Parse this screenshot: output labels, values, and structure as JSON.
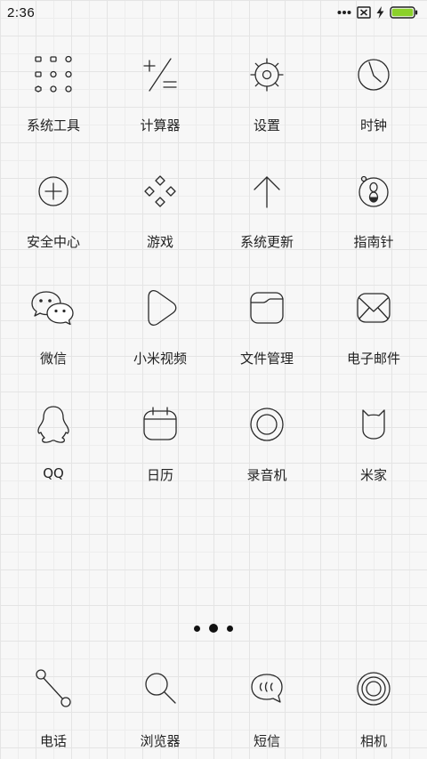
{
  "status_bar": {
    "time": "2:36",
    "battery_color": "#8bd12a",
    "icons": [
      "more-dots-icon",
      "sim-off-icon",
      "charging-bolt-icon",
      "battery-icon"
    ]
  },
  "grid_apps": [
    {
      "label": "系统工具",
      "icon": "folder-grid-icon"
    },
    {
      "label": "计算器",
      "icon": "calculator-icon"
    },
    {
      "label": "设置",
      "icon": "gear-icon"
    },
    {
      "label": "时钟",
      "icon": "clock-icon"
    },
    {
      "label": "安全中心",
      "icon": "shield-plus-icon"
    },
    {
      "label": "游戏",
      "icon": "diamonds-icon"
    },
    {
      "label": "系统更新",
      "icon": "arrow-up-icon"
    },
    {
      "label": "指南针",
      "icon": "compass-icon"
    },
    {
      "label": "微信",
      "icon": "wechat-icon"
    },
    {
      "label": "小米视频",
      "icon": "play-icon"
    },
    {
      "label": "文件管理",
      "icon": "folder-icon"
    },
    {
      "label": "电子邮件",
      "icon": "envelope-icon"
    },
    {
      "label": "QQ",
      "icon": "penguin-icon"
    },
    {
      "label": "日历",
      "icon": "calendar-icon"
    },
    {
      "label": "录音机",
      "icon": "record-icon"
    },
    {
      "label": "米家",
      "icon": "mijia-icon"
    }
  ],
  "page_indicator": {
    "count": 3,
    "active": 1
  },
  "dock_apps": [
    {
      "label": "电话",
      "icon": "phone-icon"
    },
    {
      "label": "浏览器",
      "icon": "magnifier-icon"
    },
    {
      "label": "短信",
      "icon": "message-bubble-icon"
    },
    {
      "label": "相机",
      "icon": "camera-lens-icon"
    }
  ]
}
